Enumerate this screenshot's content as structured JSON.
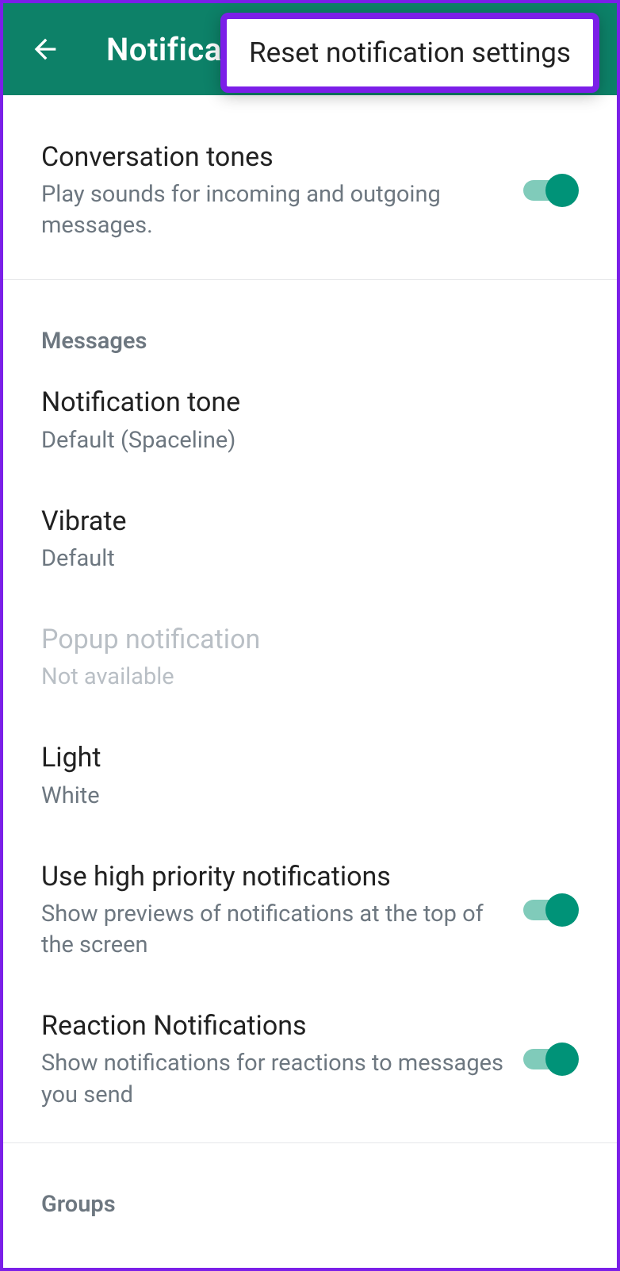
{
  "header": {
    "title": "Notifications",
    "title_truncated": "Notifica"
  },
  "popup": {
    "reset_label": "Reset notification settings"
  },
  "conversation_tones": {
    "title": "Conversation tones",
    "subtitle": "Play sounds for incoming and outgoing messages.",
    "enabled": true
  },
  "sections": {
    "messages": "Messages",
    "groups": "Groups"
  },
  "messages": {
    "notification_tone": {
      "title": "Notification tone",
      "value": "Default (Spaceline)"
    },
    "vibrate": {
      "title": "Vibrate",
      "value": "Default"
    },
    "popup_notification": {
      "title": "Popup notification",
      "value": "Not available"
    },
    "light": {
      "title": "Light",
      "value": "White"
    },
    "high_priority": {
      "title": "Use high priority notifications",
      "subtitle": "Show previews of notifications at the top of the screen",
      "enabled": true
    },
    "reaction_notifications": {
      "title": "Reaction Notifications",
      "subtitle": "Show notifications for reactions to messages you send",
      "enabled": true
    }
  }
}
